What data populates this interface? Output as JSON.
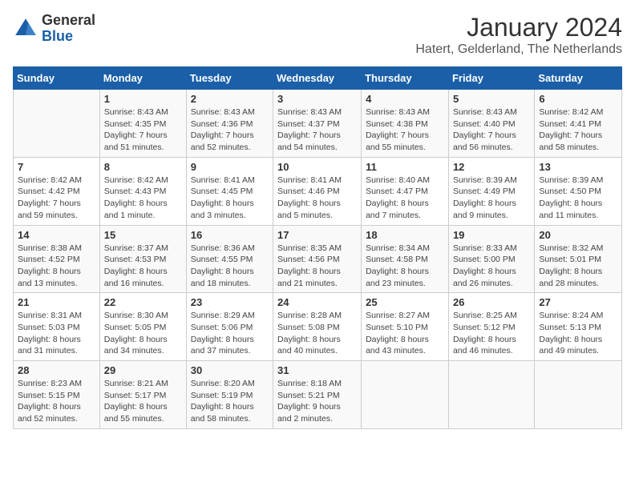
{
  "logo": {
    "general": "General",
    "blue": "Blue"
  },
  "header": {
    "title": "January 2024",
    "subtitle": "Hatert, Gelderland, The Netherlands"
  },
  "days_of_week": [
    "Sunday",
    "Monday",
    "Tuesday",
    "Wednesday",
    "Thursday",
    "Friday",
    "Saturday"
  ],
  "weeks": [
    [
      {
        "day": "",
        "info": ""
      },
      {
        "day": "1",
        "info": "Sunrise: 8:43 AM\nSunset: 4:35 PM\nDaylight: 7 hours\nand 51 minutes."
      },
      {
        "day": "2",
        "info": "Sunrise: 8:43 AM\nSunset: 4:36 PM\nDaylight: 7 hours\nand 52 minutes."
      },
      {
        "day": "3",
        "info": "Sunrise: 8:43 AM\nSunset: 4:37 PM\nDaylight: 7 hours\nand 54 minutes."
      },
      {
        "day": "4",
        "info": "Sunrise: 8:43 AM\nSunset: 4:38 PM\nDaylight: 7 hours\nand 55 minutes."
      },
      {
        "day": "5",
        "info": "Sunrise: 8:43 AM\nSunset: 4:40 PM\nDaylight: 7 hours\nand 56 minutes."
      },
      {
        "day": "6",
        "info": "Sunrise: 8:42 AM\nSunset: 4:41 PM\nDaylight: 7 hours\nand 58 minutes."
      }
    ],
    [
      {
        "day": "7",
        "info": "Sunrise: 8:42 AM\nSunset: 4:42 PM\nDaylight: 7 hours\nand 59 minutes."
      },
      {
        "day": "8",
        "info": "Sunrise: 8:42 AM\nSunset: 4:43 PM\nDaylight: 8 hours\nand 1 minute."
      },
      {
        "day": "9",
        "info": "Sunrise: 8:41 AM\nSunset: 4:45 PM\nDaylight: 8 hours\nand 3 minutes."
      },
      {
        "day": "10",
        "info": "Sunrise: 8:41 AM\nSunset: 4:46 PM\nDaylight: 8 hours\nand 5 minutes."
      },
      {
        "day": "11",
        "info": "Sunrise: 8:40 AM\nSunset: 4:47 PM\nDaylight: 8 hours\nand 7 minutes."
      },
      {
        "day": "12",
        "info": "Sunrise: 8:39 AM\nSunset: 4:49 PM\nDaylight: 8 hours\nand 9 minutes."
      },
      {
        "day": "13",
        "info": "Sunrise: 8:39 AM\nSunset: 4:50 PM\nDaylight: 8 hours\nand 11 minutes."
      }
    ],
    [
      {
        "day": "14",
        "info": "Sunrise: 8:38 AM\nSunset: 4:52 PM\nDaylight: 8 hours\nand 13 minutes."
      },
      {
        "day": "15",
        "info": "Sunrise: 8:37 AM\nSunset: 4:53 PM\nDaylight: 8 hours\nand 16 minutes."
      },
      {
        "day": "16",
        "info": "Sunrise: 8:36 AM\nSunset: 4:55 PM\nDaylight: 8 hours\nand 18 minutes."
      },
      {
        "day": "17",
        "info": "Sunrise: 8:35 AM\nSunset: 4:56 PM\nDaylight: 8 hours\nand 21 minutes."
      },
      {
        "day": "18",
        "info": "Sunrise: 8:34 AM\nSunset: 4:58 PM\nDaylight: 8 hours\nand 23 minutes."
      },
      {
        "day": "19",
        "info": "Sunrise: 8:33 AM\nSunset: 5:00 PM\nDaylight: 8 hours\nand 26 minutes."
      },
      {
        "day": "20",
        "info": "Sunrise: 8:32 AM\nSunset: 5:01 PM\nDaylight: 8 hours\nand 28 minutes."
      }
    ],
    [
      {
        "day": "21",
        "info": "Sunrise: 8:31 AM\nSunset: 5:03 PM\nDaylight: 8 hours\nand 31 minutes."
      },
      {
        "day": "22",
        "info": "Sunrise: 8:30 AM\nSunset: 5:05 PM\nDaylight: 8 hours\nand 34 minutes."
      },
      {
        "day": "23",
        "info": "Sunrise: 8:29 AM\nSunset: 5:06 PM\nDaylight: 8 hours\nand 37 minutes."
      },
      {
        "day": "24",
        "info": "Sunrise: 8:28 AM\nSunset: 5:08 PM\nDaylight: 8 hours\nand 40 minutes."
      },
      {
        "day": "25",
        "info": "Sunrise: 8:27 AM\nSunset: 5:10 PM\nDaylight: 8 hours\nand 43 minutes."
      },
      {
        "day": "26",
        "info": "Sunrise: 8:25 AM\nSunset: 5:12 PM\nDaylight: 8 hours\nand 46 minutes."
      },
      {
        "day": "27",
        "info": "Sunrise: 8:24 AM\nSunset: 5:13 PM\nDaylight: 8 hours\nand 49 minutes."
      }
    ],
    [
      {
        "day": "28",
        "info": "Sunrise: 8:23 AM\nSunset: 5:15 PM\nDaylight: 8 hours\nand 52 minutes."
      },
      {
        "day": "29",
        "info": "Sunrise: 8:21 AM\nSunset: 5:17 PM\nDaylight: 8 hours\nand 55 minutes."
      },
      {
        "day": "30",
        "info": "Sunrise: 8:20 AM\nSunset: 5:19 PM\nDaylight: 8 hours\nand 58 minutes."
      },
      {
        "day": "31",
        "info": "Sunrise: 8:18 AM\nSunset: 5:21 PM\nDaylight: 9 hours\nand 2 minutes."
      },
      {
        "day": "",
        "info": ""
      },
      {
        "day": "",
        "info": ""
      },
      {
        "day": "",
        "info": ""
      }
    ]
  ]
}
